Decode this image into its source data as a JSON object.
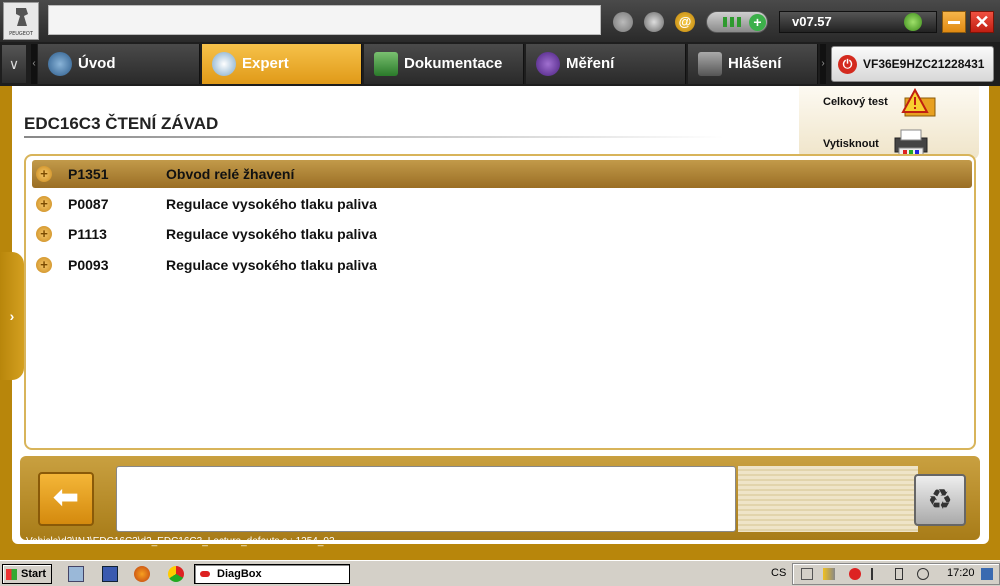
{
  "topbar": {
    "logo_text": "PEUGEOT",
    "version": "v07.57",
    "icons": [
      "anchor-icon",
      "face-icon",
      "at-icon",
      "battery-icon",
      "leaf-icon"
    ]
  },
  "tabs": [
    {
      "label": "Úvod",
      "icon": "home-icon"
    },
    {
      "label": "Expert",
      "icon": "magnifier-icon",
      "active": true
    },
    {
      "label": "Dokumentace",
      "icon": "book-icon"
    },
    {
      "label": "Měření",
      "icon": "waveform-icon"
    },
    {
      "label": "Hlášení",
      "icon": "notepad-icon"
    }
  ],
  "vehicle": {
    "vin": "VF36E9HZC21228431"
  },
  "page": {
    "title": "EDC16C3  ČTENÍ ZÁVAD"
  },
  "actions": {
    "global_test": "Celkový test",
    "print": "Vytisknout"
  },
  "faults": [
    {
      "code": "P1351",
      "description": "Obvod relé žhavení",
      "selected": true
    },
    {
      "code": "P0087",
      "description": "Regulace vysokého tlaku paliva"
    },
    {
      "code": "P1113",
      "description": "Regulace vysokého tlaku paliva"
    },
    {
      "code": "P0093",
      "description": "Regulace vysokého tlaku paliva"
    }
  ],
  "footer": {
    "path": "Vehicle\\d2\\INJ\\EDC16C3\\d2_EDC16C3_Lecture_defauts.s : 1254_02"
  },
  "taskbar": {
    "start": "Start",
    "task": "DiagBox",
    "lang": "CS",
    "clock": "17:20"
  },
  "colors": {
    "accent": "#e09a18",
    "panel": "#b8860b",
    "selected_row": "#a87c2a"
  }
}
